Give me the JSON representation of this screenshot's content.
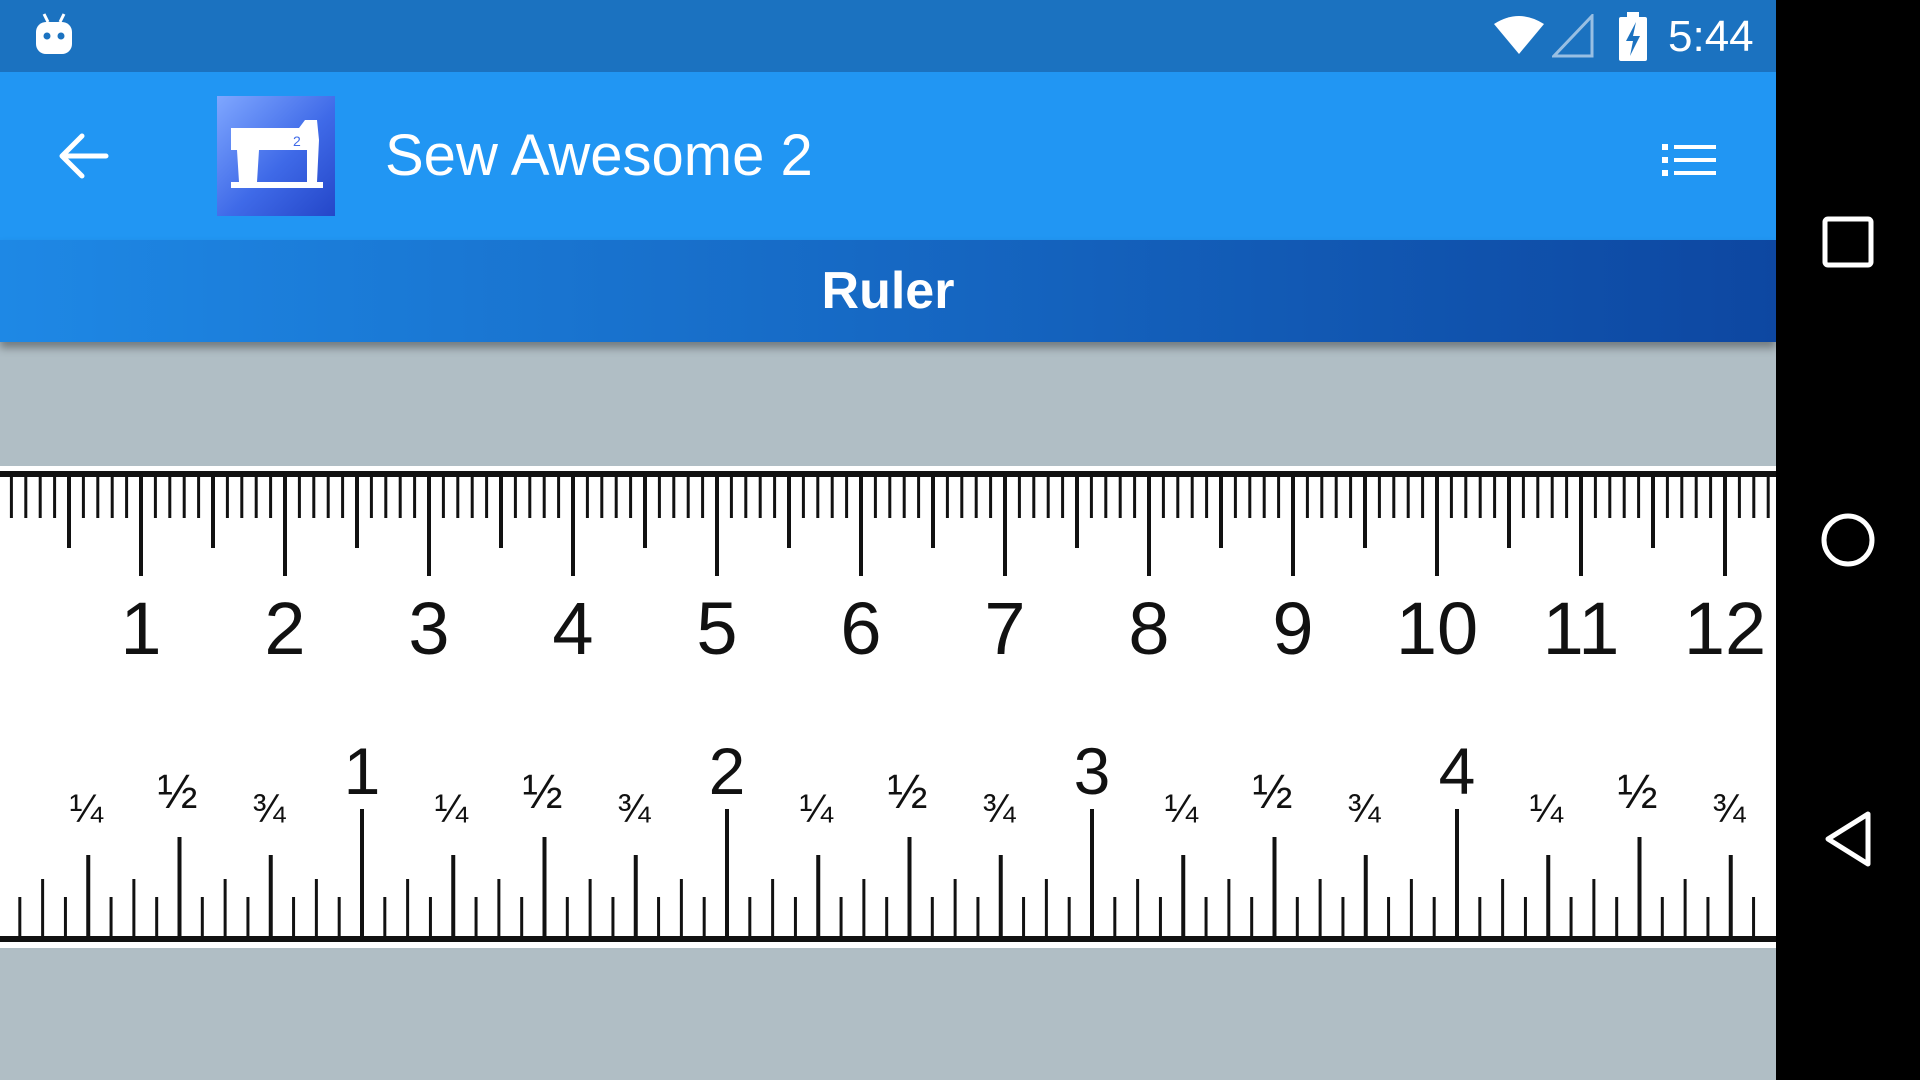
{
  "status_bar": {
    "time": "5:44",
    "icons": [
      "android-debug-icon",
      "wifi-icon",
      "cell-signal-icon",
      "battery-charging-icon"
    ]
  },
  "app_bar": {
    "title": "Sew Awesome 2",
    "back_icon": "back-arrow-icon",
    "logo_icon": "sewing-machine-icon",
    "menu_icon": "list-menu-icon"
  },
  "page": {
    "title": "Ruler"
  },
  "ruler": {
    "cm_labels": [
      "1",
      "2",
      "3",
      "4",
      "5",
      "6",
      "7",
      "8",
      "9",
      "10",
      "11",
      "12"
    ],
    "inch_labels": [
      "1",
      "2",
      "3",
      "4"
    ],
    "fraction_labels": [
      "¼",
      "½",
      "¾"
    ]
  },
  "nav_bar": {
    "icons": [
      "recents-square-icon",
      "home-circle-icon",
      "back-triangle-icon"
    ]
  },
  "colors": {
    "status_bar": "#1b72c0",
    "app_bar": "#2196f3",
    "header_start": "#1e88e5",
    "header_end": "#0d47a1",
    "background": "#b0bec5"
  }
}
